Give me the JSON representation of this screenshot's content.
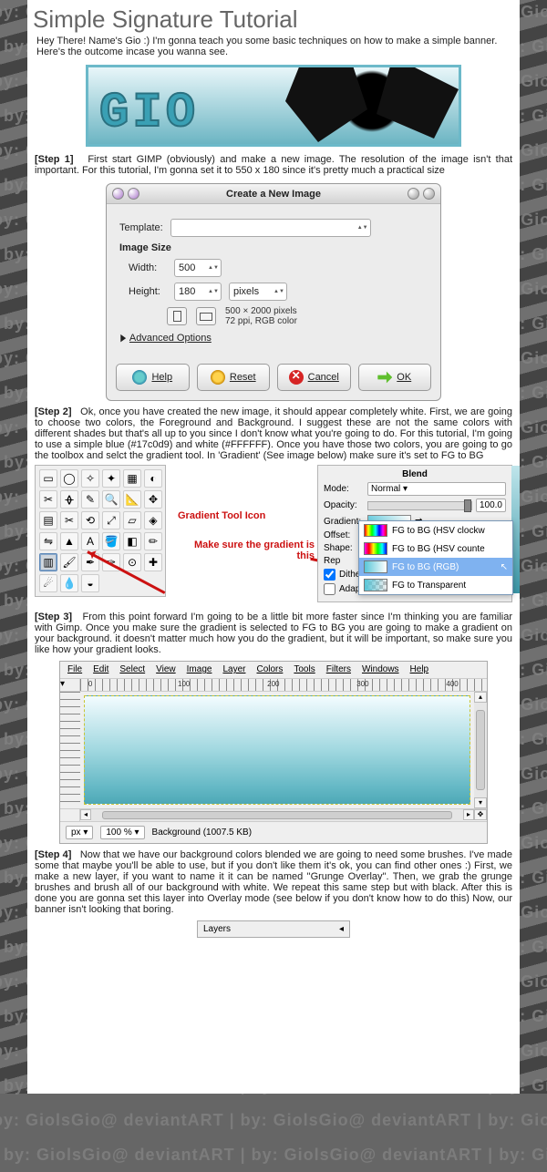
{
  "watermark": "by: GiolsGio@ deviantART | by: GiolsGio@ deviantART | by: GiolsG",
  "title": "Simple Signature Tutorial",
  "intro": "Hey There! Name's Gio :) I'm gonna teach you some basic techniques on how to make a simple banner. Here's the outcome incase you wanna see.",
  "banner_text": "GIO",
  "step1": {
    "label": "[Step 1]",
    "text": "First start GIMP (obviously) and make a new image. The resolution of the image isn't that important. For this tutorial, I'm gonna set it to 550 x 180 since it's pretty much a practical size"
  },
  "dialog": {
    "title": "Create a New Image",
    "template_label": "Template:",
    "template_value": "",
    "size_heading": "Image Size",
    "width_label": "Width:",
    "width_value": "500",
    "height_label": "Height:",
    "height_value": "180",
    "units": "pixels",
    "meta_line1": "500 × 2000 pixels",
    "meta_line2": "72 ppi, RGB color",
    "advanced": "Advanced Options",
    "buttons": {
      "help": "Help",
      "reset": "Reset",
      "cancel": "Cancel",
      "ok": "OK"
    }
  },
  "step2": {
    "label": "[Step 2]",
    "text": "Ok, once you have created the new image, it should appear completely white. First, we are going to choose two colors, the Foreground and Background. I suggest these are not the same colors with different shades but that's all up to you since I don't know what you're going to do. For this tutorial, I'm going to use a simple blue (#17c0d9) and white (#FFFFFF).  Once you have those two colors, you are going to go the toolbox and selct the gradient tool. In 'Gradient' (See image below) make sure it's set to FG to BG"
  },
  "anno1": "Gradient Tool Icon",
  "anno2": "Make sure the gradient is this",
  "blend": {
    "title": "Blend",
    "mode_label": "Mode:",
    "mode_value": "Normal",
    "opacity_label": "Opacity:",
    "opacity_value": "100.0",
    "gradient_label": "Gradient:",
    "offset_label": "Offset:",
    "shape_label": "Shape:",
    "rep_label": "Rep",
    "dither": "Dithe",
    "adaptive": "Adap",
    "options": {
      "o1": "FG to BG (HSV clockw",
      "o2": "FG to BG (HSV counte",
      "o3": "FG to BG (RGB)",
      "o4": "FG to Transparent"
    }
  },
  "step3": {
    "label": "[Step 3]",
    "text": "From this point forward I'm going to be a little bit more faster since I'm thinking you are familiar with Gimp. Once you make sure the gradient is selected to FG to BG you are going to make a gradient on your background. it doesn't matter much how you do the gradient, but it will be important, so make sure you like how your gradient looks."
  },
  "menus": [
    "File",
    "Edit",
    "Select",
    "View",
    "Image",
    "Layer",
    "Colors",
    "Tools",
    "Filters",
    "Windows",
    "Help"
  ],
  "ruler_ticks": [
    "0",
    "100",
    "200",
    "300",
    "400"
  ],
  "status": {
    "unit": "px",
    "zoom": "100 %",
    "layer": "Background (1007.5 KB)"
  },
  "step4": {
    "label": "[Step 4]",
    "text": "Now that we have our background colors blended we are going to need some brushes. I've made some that maybe you'll be able to use, but if you don't like them it's ok, you can find other ones :) First, we make a new layer, if you want to name it it can be named \"Grunge Overlay\". Then, we grab the grunge brushes and brush all of our background with white. We repeat this same step but with black. After this is done you are gonna set this layer into Overlay mode (see below if you don't know how to do this) Now, our banner isn't looking that boring."
  },
  "layers_title": "Layers"
}
